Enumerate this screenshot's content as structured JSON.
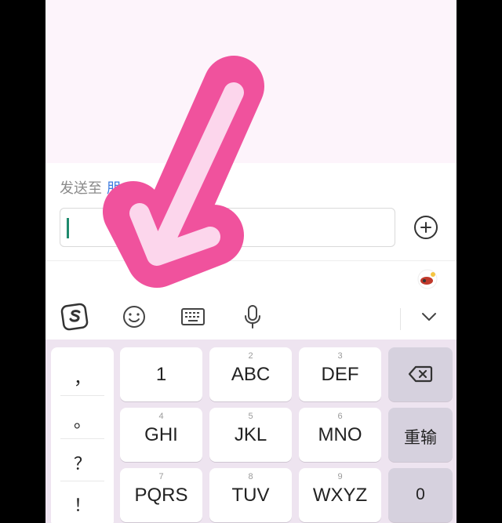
{
  "compose": {
    "send_to_label": "发送至",
    "send_to_target": "朋",
    "input_value": "",
    "input_placeholder": ""
  },
  "toolbar": {
    "icons": [
      "sogou-logo-icon",
      "emoji-icon",
      "keyboard-icon",
      "microphone-icon",
      "chevron-down-icon"
    ]
  },
  "keyboard": {
    "symbols": [
      "，",
      "。",
      "？",
      "！"
    ],
    "keys": [
      {
        "num": "",
        "label": "1"
      },
      {
        "num": "2",
        "label": "ABC"
      },
      {
        "num": "3",
        "label": "DEF"
      },
      {
        "num": "4",
        "label": "GHI"
      },
      {
        "num": "5",
        "label": "JKL"
      },
      {
        "num": "6",
        "label": "MNO"
      },
      {
        "num": "7",
        "label": "PQRS"
      },
      {
        "num": "8",
        "label": "TUV"
      },
      {
        "num": "9",
        "label": "WXYZ"
      }
    ],
    "fn_keys": {
      "backspace": "",
      "reenter": "重输",
      "zero": "0"
    }
  },
  "colors": {
    "arrow_pink": "#f0529d",
    "arrow_light": "#fcd6ec",
    "link_blue": "#3d7be0",
    "caret_green": "#1f8a6d"
  }
}
